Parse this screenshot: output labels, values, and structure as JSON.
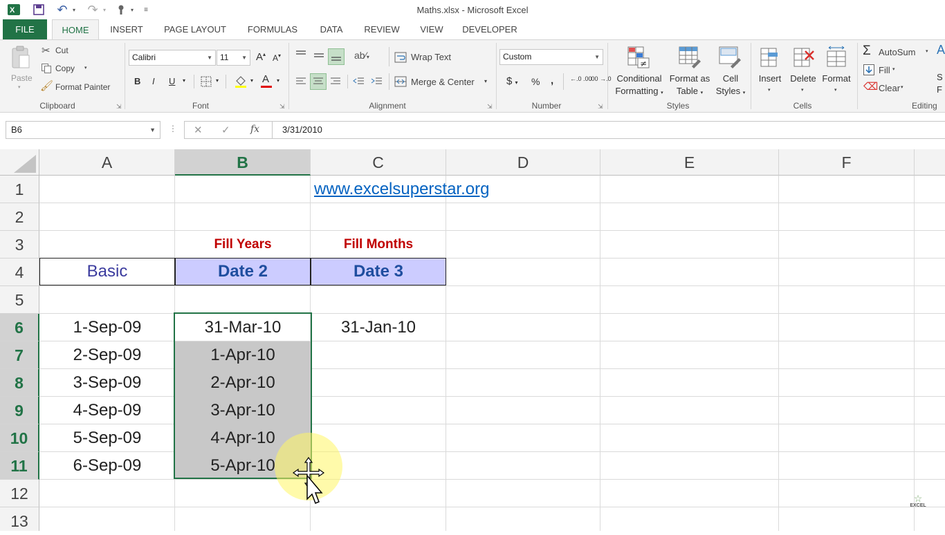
{
  "window": {
    "title": "Maths.xlsx - Microsoft Excel"
  },
  "tabs": [
    "FILE",
    "HOME",
    "INSERT",
    "PAGE LAYOUT",
    "FORMULAS",
    "DATA",
    "REVIEW",
    "VIEW",
    "DEVELOPER"
  ],
  "ribbon": {
    "clipboard": {
      "paste": "Paste",
      "cut": "Cut",
      "copy": "Copy",
      "format_painter": "Format Painter",
      "label": "Clipboard"
    },
    "font": {
      "name": "Calibri",
      "size": "11",
      "grow": "A",
      "shrink": "A",
      "bold": "B",
      "italic": "I",
      "underline": "U",
      "font_color_letter": "A",
      "label": "Font"
    },
    "alignment": {
      "wrap_text": "Wrap Text",
      "merge_center": "Merge & Center",
      "label": "Alignment"
    },
    "number": {
      "format": "Custom",
      "currency": "$",
      "percent": "%",
      "comma": ",",
      "inc_decimal": "←.0 .00",
      "dec_decimal": ".00 →.0",
      "label": "Number"
    },
    "styles": {
      "conditional_line1": "Conditional",
      "conditional_line2": "Formatting",
      "format_table_line1": "Format as",
      "format_table_line2": "Table",
      "cell_styles_line1": "Cell",
      "cell_styles_line2": "Styles",
      "label": "Styles"
    },
    "cells": {
      "insert": "Insert",
      "delete": "Delete",
      "format": "Format",
      "label": "Cells"
    },
    "editing": {
      "autosum": "AutoSum",
      "fill": "Fill",
      "clear": "Clear",
      "sort_partial": "S",
      "find_partial": "F",
      "label": "Editing"
    }
  },
  "formula_bar": {
    "name_box": "B6",
    "cancel": "✕",
    "enter": "✓",
    "fx": "fx",
    "value": "3/31/2010"
  },
  "grid": {
    "columns": [
      "A",
      "B",
      "C",
      "D",
      "E",
      "F"
    ],
    "rows": [
      "1",
      "2",
      "3",
      "4",
      "5",
      "6",
      "7",
      "8",
      "9",
      "10",
      "11",
      "12",
      "13"
    ],
    "selected_column": "B",
    "selected_rows": [
      "6",
      "7",
      "8",
      "9",
      "10",
      "11"
    ],
    "link": "www.excelsuperstar.org",
    "headers": {
      "fill_years": "Fill Years",
      "fill_months": "Fill Months",
      "basic": "Basic",
      "date2": "Date 2",
      "date3": "Date 3"
    },
    "col_a": [
      "1-Sep-09",
      "2-Sep-09",
      "3-Sep-09",
      "4-Sep-09",
      "5-Sep-09",
      "6-Sep-09"
    ],
    "col_b": [
      "31-Mar-10",
      "1-Apr-10",
      "2-Apr-10",
      "3-Apr-10",
      "4-Apr-10",
      "5-Apr-10"
    ],
    "col_c": [
      "31-Jan-10"
    ]
  },
  "watermark": "EXCEL",
  "colors": {
    "excel_green": "#217346",
    "header_fill": "#ccccff",
    "red_text": "#c00000",
    "blue_text": "#1f4e9f",
    "link_blue": "#0563c1",
    "selection_gray": "#c8c8c8"
  }
}
